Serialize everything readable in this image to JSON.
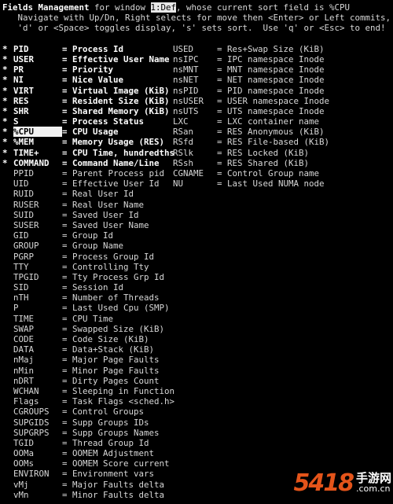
{
  "header": {
    "title": "Fields Management",
    "pre_window": " for window ",
    "window_label": "1:Def",
    "post_window": ", whose current sort field is %CPU",
    "line2": "   Navigate with Up/Dn, Right selects for move then <Enter> or Left commits,",
    "line3": "   'd' or <Space> toggles display, 's' sets sort.  Use 'q' or <Esc> to end!"
  },
  "rows": [
    {
      "mark": "*",
      "name": "PID",
      "desc": "= Process Id",
      "name2": "USED",
      "desc2": "= Res+Swap Size (KiB)"
    },
    {
      "mark": "*",
      "name": "USER",
      "desc": "= Effective User Name",
      "name2": "nsIPC",
      "desc2": "= IPC namespace Inode"
    },
    {
      "mark": "*",
      "name": "PR",
      "desc": "= Priority",
      "name2": "nsMNT",
      "desc2": "= MNT namespace Inode"
    },
    {
      "mark": "*",
      "name": "NI",
      "desc": "= Nice Value",
      "name2": "nsNET",
      "desc2": "= NET namespace Inode"
    },
    {
      "mark": "*",
      "name": "VIRT",
      "desc": "= Virtual Image (KiB)",
      "name2": "nsPID",
      "desc2": "= PID namespace Inode"
    },
    {
      "mark": "*",
      "name": "RES",
      "desc": "= Resident Size (KiB)",
      "name2": "nsUSER",
      "desc2": "= USER namespace Inode"
    },
    {
      "mark": "*",
      "name": "SHR",
      "desc": "= Shared Memory (KiB)",
      "name2": "nsUTS",
      "desc2": "= UTS namespace Inode"
    },
    {
      "mark": "*",
      "name": "S",
      "desc": "= Process Status",
      "name2": "LXC",
      "desc2": "= LXC container name"
    },
    {
      "mark": "*",
      "name": "%CPU",
      "desc": "= CPU Usage",
      "name2": "RSan",
      "desc2": "= RES Anonymous (KiB)"
    },
    {
      "mark": "*",
      "name": "%MEM",
      "desc": "= Memory Usage (RES)",
      "name2": "RSfd",
      "desc2": "= RES File-based (KiB)"
    },
    {
      "mark": "*",
      "name": "TIME+",
      "desc": "= CPU Time, hundredths",
      "name2": "RSlk",
      "desc2": "= RES Locked (KiB)"
    },
    {
      "mark": "*",
      "name": "COMMAND",
      "desc": "= Command Name/Line",
      "name2": "RSsh",
      "desc2": "= RES Shared (KiB)"
    },
    {
      "mark": "",
      "name": "PPID",
      "desc": "= Parent Process pid",
      "name2": "CGNAME",
      "desc2": "= Control Group name"
    },
    {
      "mark": "",
      "name": "UID",
      "desc": "= Effective User Id",
      "name2": "NU",
      "desc2": "= Last Used NUMA node"
    },
    {
      "mark": "",
      "name": "RUID",
      "desc": "= Real User Id",
      "name2": "",
      "desc2": ""
    },
    {
      "mark": "",
      "name": "RUSER",
      "desc": "= Real User Name",
      "name2": "",
      "desc2": ""
    },
    {
      "mark": "",
      "name": "SUID",
      "desc": "= Saved User Id",
      "name2": "",
      "desc2": ""
    },
    {
      "mark": "",
      "name": "SUSER",
      "desc": "= Saved User Name",
      "name2": "",
      "desc2": ""
    },
    {
      "mark": "",
      "name": "GID",
      "desc": "= Group Id",
      "name2": "",
      "desc2": ""
    },
    {
      "mark": "",
      "name": "GROUP",
      "desc": "= Group Name",
      "name2": "",
      "desc2": ""
    },
    {
      "mark": "",
      "name": "PGRP",
      "desc": "= Process Group Id",
      "name2": "",
      "desc2": ""
    },
    {
      "mark": "",
      "name": "TTY",
      "desc": "= Controlling Tty",
      "name2": "",
      "desc2": ""
    },
    {
      "mark": "",
      "name": "TPGID",
      "desc": "= Tty Process Grp Id",
      "name2": "",
      "desc2": ""
    },
    {
      "mark": "",
      "name": "SID",
      "desc": "= Session Id",
      "name2": "",
      "desc2": ""
    },
    {
      "mark": "",
      "name": "nTH",
      "desc": "= Number of Threads",
      "name2": "",
      "desc2": ""
    },
    {
      "mark": "",
      "name": "P",
      "desc": "= Last Used Cpu (SMP)",
      "name2": "",
      "desc2": ""
    },
    {
      "mark": "",
      "name": "TIME",
      "desc": "= CPU Time",
      "name2": "",
      "desc2": ""
    },
    {
      "mark": "",
      "name": "SWAP",
      "desc": "= Swapped Size (KiB)",
      "name2": "",
      "desc2": ""
    },
    {
      "mark": "",
      "name": "CODE",
      "desc": "= Code Size (KiB)",
      "name2": "",
      "desc2": ""
    },
    {
      "mark": "",
      "name": "DATA",
      "desc": "= Data+Stack (KiB)",
      "name2": "",
      "desc2": ""
    },
    {
      "mark": "",
      "name": "nMaj",
      "desc": "= Major Page Faults",
      "name2": "",
      "desc2": ""
    },
    {
      "mark": "",
      "name": "nMin",
      "desc": "= Minor Page Faults",
      "name2": "",
      "desc2": ""
    },
    {
      "mark": "",
      "name": "nDRT",
      "desc": "= Dirty Pages Count",
      "name2": "",
      "desc2": ""
    },
    {
      "mark": "",
      "name": "WCHAN",
      "desc": "= Sleeping in Function",
      "name2": "",
      "desc2": ""
    },
    {
      "mark": "",
      "name": "Flags",
      "desc": "= Task Flags <sched.h>",
      "name2": "",
      "desc2": ""
    },
    {
      "mark": "",
      "name": "CGROUPS",
      "desc": "= Control Groups",
      "name2": "",
      "desc2": ""
    },
    {
      "mark": "",
      "name": "SUPGIDS",
      "desc": "= Supp Groups IDs",
      "name2": "",
      "desc2": ""
    },
    {
      "mark": "",
      "name": "SUPGRPS",
      "desc": "= Supp Groups Names",
      "name2": "",
      "desc2": ""
    },
    {
      "mark": "",
      "name": "TGID",
      "desc": "= Thread Group Id",
      "name2": "",
      "desc2": ""
    },
    {
      "mark": "",
      "name": "OOMa",
      "desc": "= OOMEM Adjustment",
      "name2": "",
      "desc2": ""
    },
    {
      "mark": "",
      "name": "OOMs",
      "desc": "= OOMEM Score current",
      "name2": "",
      "desc2": ""
    },
    {
      "mark": "",
      "name": "ENVIRON",
      "desc": "= Environment vars",
      "name2": "",
      "desc2": ""
    },
    {
      "mark": "",
      "name": "vMj",
      "desc": "= Major Faults delta",
      "name2": "",
      "desc2": ""
    },
    {
      "mark": "",
      "name": "vMn",
      "desc": "= Minor Faults delta",
      "name2": "",
      "desc2": ""
    }
  ],
  "cursor_row": 8,
  "watermark": {
    "num": "54",
    "mid": "1",
    "end": "8",
    "cn": "手游网",
    "url": ".com.cn"
  }
}
